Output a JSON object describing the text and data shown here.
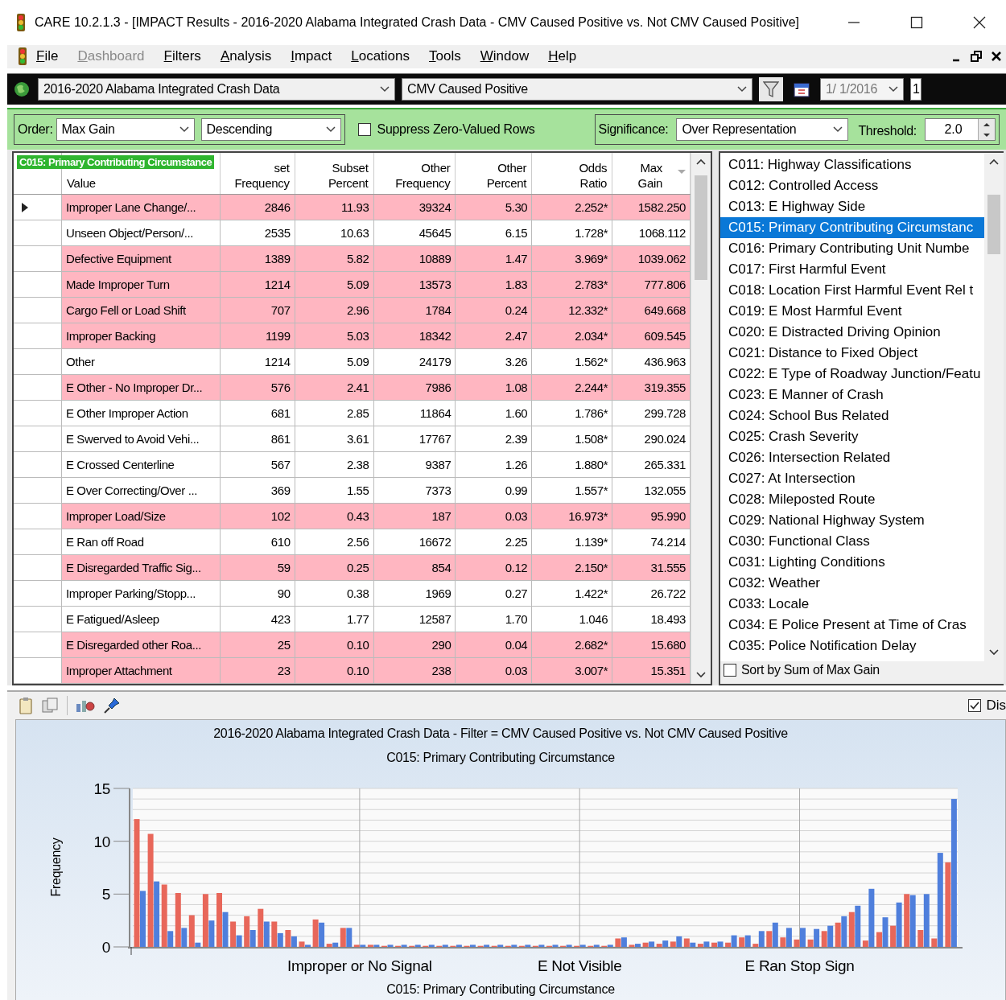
{
  "window": {
    "title": "CARE 10.2.1.3 - [IMPACT Results - 2016-2020 Alabama Integrated Crash Data - CMV Caused Positive vs. Not CMV Caused Positive]"
  },
  "menu": [
    {
      "label": "File",
      "disabled": false
    },
    {
      "label": "Dashboard",
      "disabled": true
    },
    {
      "label": "Filters",
      "disabled": false
    },
    {
      "label": "Analysis",
      "disabled": false
    },
    {
      "label": "Impact",
      "disabled": false
    },
    {
      "label": "Locations",
      "disabled": false
    },
    {
      "label": "Tools",
      "disabled": false
    },
    {
      "label": "Window",
      "disabled": false
    },
    {
      "label": "Help",
      "disabled": false
    }
  ],
  "toolbar": {
    "dataset": "2016-2020 Alabama Integrated Crash Data",
    "filter": "CMV Caused Positive",
    "start_date": "1/ 1/2016",
    "end_date": "1"
  },
  "options": {
    "order_label": "Order:",
    "order": "Max Gain",
    "direction": "Descending",
    "suppress_label": "Suppress Zero-Valued Rows",
    "suppress_checked": false,
    "significance_label": "Significance:",
    "significance": "Over Representation",
    "threshold_label": "Threshold:",
    "threshold": "2.0"
  },
  "table": {
    "overlay": "C015: Primary Contributing Circumstance",
    "columns": [
      {
        "lines": [
          "Value"
        ]
      },
      {
        "lines": [
          "set",
          "Frequency"
        ]
      },
      {
        "lines": [
          "Subset",
          "Percent"
        ]
      },
      {
        "lines": [
          "Other",
          "Frequency"
        ]
      },
      {
        "lines": [
          "Other",
          "Percent"
        ]
      },
      {
        "lines": [
          "Odds",
          "Ratio"
        ]
      },
      {
        "lines": [
          "Max",
          "Gain"
        ]
      }
    ],
    "rows": [
      {
        "current": true,
        "highlighted": true,
        "cells": [
          "Improper Lane Change/...",
          "2846",
          "11.93",
          "39324",
          "5.30",
          "2.252*",
          "1582.250"
        ]
      },
      {
        "current": false,
        "highlighted": false,
        "cells": [
          "Unseen Object/Person/...",
          "2535",
          "10.63",
          "45645",
          "6.15",
          "1.728*",
          "1068.112"
        ]
      },
      {
        "current": false,
        "highlighted": true,
        "cells": [
          "Defective Equipment",
          "1389",
          "5.82",
          "10889",
          "1.47",
          "3.969*",
          "1039.062"
        ]
      },
      {
        "current": false,
        "highlighted": true,
        "cells": [
          "Made Improper Turn",
          "1214",
          "5.09",
          "13573",
          "1.83",
          "2.783*",
          "777.806"
        ]
      },
      {
        "current": false,
        "highlighted": true,
        "cells": [
          "Cargo Fell or Load Shift",
          "707",
          "2.96",
          "1784",
          "0.24",
          "12.332*",
          "649.668"
        ]
      },
      {
        "current": false,
        "highlighted": true,
        "cells": [
          "Improper Backing",
          "1199",
          "5.03",
          "18342",
          "2.47",
          "2.034*",
          "609.545"
        ]
      },
      {
        "current": false,
        "highlighted": false,
        "cells": [
          "Other",
          "1214",
          "5.09",
          "24179",
          "3.26",
          "1.562*",
          "436.963"
        ]
      },
      {
        "current": false,
        "highlighted": true,
        "cells": [
          "E Other - No Improper Dr...",
          "576",
          "2.41",
          "7986",
          "1.08",
          "2.244*",
          "319.355"
        ]
      },
      {
        "current": false,
        "highlighted": false,
        "cells": [
          "E Other Improper Action",
          "681",
          "2.85",
          "11864",
          "1.60",
          "1.786*",
          "299.728"
        ]
      },
      {
        "current": false,
        "highlighted": false,
        "cells": [
          "E Swerved to Avoid Vehi...",
          "861",
          "3.61",
          "17767",
          "2.39",
          "1.508*",
          "290.024"
        ]
      },
      {
        "current": false,
        "highlighted": false,
        "cells": [
          "E Crossed Centerline",
          "567",
          "2.38",
          "9387",
          "1.26",
          "1.880*",
          "265.331"
        ]
      },
      {
        "current": false,
        "highlighted": false,
        "cells": [
          "E Over Correcting/Over ...",
          "369",
          "1.55",
          "7373",
          "0.99",
          "1.557*",
          "132.055"
        ]
      },
      {
        "current": false,
        "highlighted": true,
        "cells": [
          "Improper Load/Size",
          "102",
          "0.43",
          "187",
          "0.03",
          "16.973*",
          "95.990"
        ]
      },
      {
        "current": false,
        "highlighted": false,
        "cells": [
          "E Ran off Road",
          "610",
          "2.56",
          "16672",
          "2.25",
          "1.139*",
          "74.214"
        ]
      },
      {
        "current": false,
        "highlighted": true,
        "cells": [
          "E Disregarded Traffic Sig...",
          "59",
          "0.25",
          "854",
          "0.12",
          "2.150*",
          "31.555"
        ]
      },
      {
        "current": false,
        "highlighted": false,
        "cells": [
          "Improper Parking/Stopp...",
          "90",
          "0.38",
          "1969",
          "0.27",
          "1.422*",
          "26.722"
        ]
      },
      {
        "current": false,
        "highlighted": false,
        "cells": [
          "E Fatigued/Asleep",
          "423",
          "1.77",
          "12587",
          "1.70",
          "1.046",
          "18.493"
        ]
      },
      {
        "current": false,
        "highlighted": true,
        "cells": [
          "E Disregarded other Roa...",
          "25",
          "0.10",
          "290",
          "0.04",
          "2.682*",
          "15.680"
        ]
      },
      {
        "current": false,
        "highlighted": true,
        "cells": [
          "Improper Attachment",
          "23",
          "0.10",
          "238",
          "0.03",
          "3.007*",
          "15.351"
        ]
      }
    ]
  },
  "variables": {
    "items": [
      {
        "label": "C011: Highway Classifications",
        "selected": false
      },
      {
        "label": "C012: Controlled Access",
        "selected": false
      },
      {
        "label": "C013: E Highway Side",
        "selected": false
      },
      {
        "label": "C015: Primary Contributing Circumstanc",
        "selected": true
      },
      {
        "label": "C016: Primary Contributing Unit Numbe",
        "selected": false
      },
      {
        "label": "C017: First Harmful Event",
        "selected": false
      },
      {
        "label": "C018: Location First Harmful Event Rel t",
        "selected": false
      },
      {
        "label": "C019: E Most Harmful Event",
        "selected": false
      },
      {
        "label": "C020: E Distracted Driving Opinion",
        "selected": false
      },
      {
        "label": "C021: Distance to Fixed Object",
        "selected": false
      },
      {
        "label": "C022: E Type of Roadway Junction/Featu",
        "selected": false
      },
      {
        "label": "C023: E Manner of Crash",
        "selected": false
      },
      {
        "label": "C024: School Bus Related",
        "selected": false
      },
      {
        "label": "C025: Crash Severity",
        "selected": false
      },
      {
        "label": "C026: Intersection Related",
        "selected": false
      },
      {
        "label": "C027: At Intersection",
        "selected": false
      },
      {
        "label": "C028: Mileposted Route",
        "selected": false
      },
      {
        "label": "C029: National Highway System",
        "selected": false
      },
      {
        "label": "C030: Functional Class",
        "selected": false
      },
      {
        "label": "C031: Lighting Conditions",
        "selected": false
      },
      {
        "label": "C032: Weather",
        "selected": false
      },
      {
        "label": "C033: Locale",
        "selected": false
      },
      {
        "label": "C034: E Police Present at Time of Cras",
        "selected": false
      },
      {
        "label": "C035: Police Notification Delay",
        "selected": false
      }
    ],
    "sort_label": "Sort by Sum of Max Gain",
    "sort_checked": false
  },
  "chart_pane": {
    "display_label": "Dis",
    "display_checked": true,
    "subtitle": "C015: Primary Contributing Circumstance",
    "chart_data": {
      "type": "bar",
      "title": "2016-2020 Alabama Integrated Crash Data - Filter = CMV Caused Positive vs. Not CMV Caused Positive",
      "xlabel": "C015: Primary Contributing Circumstance",
      "ylabel": "Frequency",
      "categories": [
        null,
        null,
        null,
        null,
        null,
        null,
        null,
        null,
        null,
        null,
        null,
        null,
        null,
        null,
        null,
        null,
        "Improper or No Signal",
        null,
        null,
        null,
        null,
        null,
        null,
        null,
        null,
        null,
        null,
        null,
        null,
        null,
        null,
        null,
        "E Not Visible",
        null,
        null,
        null,
        null,
        null,
        null,
        null,
        null,
        null,
        null,
        null,
        null,
        null,
        null,
        null,
        "E Ran Stop Sign",
        null,
        null,
        null,
        null,
        null,
        null,
        null,
        null,
        null,
        null,
        null
      ],
      "series": [
        {
          "color": "#e8675a",
          "values": [
            12.1,
            10.7,
            5.9,
            5.1,
            3.0,
            5.0,
            5.1,
            2.4,
            2.9,
            3.6,
            2.4,
            1.6,
            0.5,
            2.6,
            0.3,
            1.8,
            0.2,
            0.2,
            0.1,
            0.1,
            0.1,
            0.1,
            0.1,
            0.1,
            0.1,
            0.1,
            0.1,
            0.1,
            0.1,
            0.1,
            0.1,
            0.1,
            0.1,
            0.1,
            0.1,
            0.8,
            0.2,
            0.4,
            0.3,
            0.5,
            0.8,
            0.3,
            0.4,
            0.4,
            0.9,
            0.3,
            1.5,
            0.9,
            0.7,
            0.7,
            1.5,
            2.3,
            3.3,
            0.6,
            1.4,
            2.0,
            5.0,
            1.6,
            0.8,
            8.0
          ]
        },
        {
          "color": "#4f7fdc",
          "values": [
            5.3,
            6.2,
            1.5,
            1.8,
            0.4,
            2.5,
            3.3,
            1.1,
            1.6,
            2.4,
            1.3,
            1.0,
            0.2,
            2.3,
            0.4,
            1.8,
            0.2,
            0.2,
            0.2,
            0.2,
            0.2,
            0.2,
            0.2,
            0.2,
            0.2,
            0.2,
            0.2,
            0.2,
            0.2,
            0.2,
            0.2,
            0.2,
            0.2,
            0.2,
            0.2,
            0.9,
            0.3,
            0.5,
            0.6,
            1.0,
            0.4,
            0.5,
            0.5,
            1.1,
            1.1,
            1.5,
            2.3,
            1.8,
            1.8,
            1.7,
            2.0,
            2.9,
            3.9,
            5.5,
            2.8,
            4.2,
            4.9,
            5.0,
            8.9,
            14.0
          ]
        }
      ],
      "ylim": [
        0,
        15
      ],
      "yticks": [
        0,
        5,
        10,
        15
      ],
      "grid": true
    }
  }
}
